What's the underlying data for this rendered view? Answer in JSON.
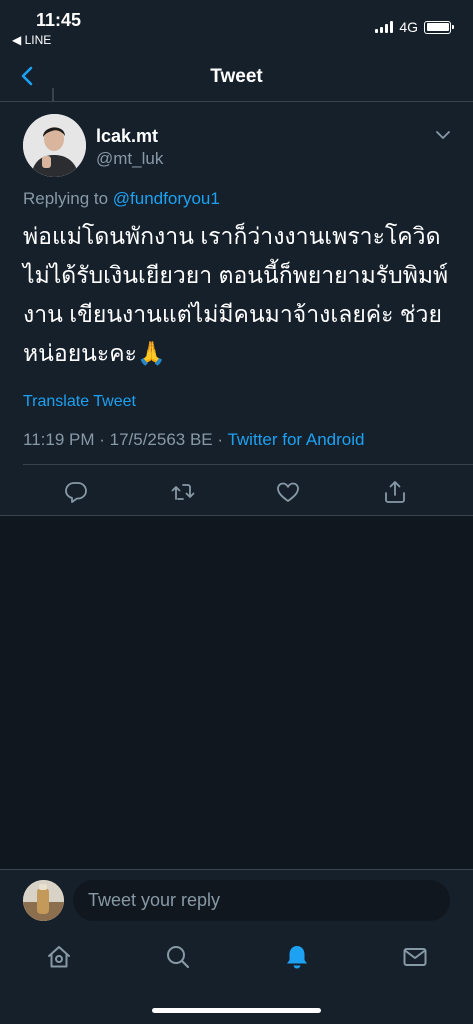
{
  "status_bar": {
    "time": "11:45",
    "back_app": "◀ LINE",
    "network": "4G"
  },
  "nav": {
    "title": "Tweet",
    "back_icon": "chevron-left-icon"
  },
  "tweet": {
    "display_name": "lcak.mt",
    "handle": "@mt_luk",
    "replying_prefix": "Replying to",
    "replying_to": "@fundforyou1",
    "text": "พ่อแม่โดนพักงาน เราก็ว่างงานเพราะโควิด ไม่ได้รับเงินเยียวยา ตอนนี้ก็พยายามรับพิมพ์งาน เขียนงานแต่ไม่มีคนมาจ้างเลยค่ะ ช่วยหน่อยนะคะ🙏",
    "translate_label": "Translate Tweet",
    "timestamp": "11:19 PM · 17/5/2563 BE · ",
    "source": "Twitter for Android",
    "actions": [
      "reply-icon",
      "retweet-icon",
      "like-icon",
      "share-icon"
    ]
  },
  "reply": {
    "placeholder": "Tweet your reply"
  },
  "tabs": [
    "home-icon",
    "search-icon",
    "notifications-icon",
    "messages-icon"
  ],
  "colors": {
    "background": "#15202b",
    "accent": "#1da1f2",
    "secondary_text": "#8899a6",
    "border": "#38444d"
  }
}
